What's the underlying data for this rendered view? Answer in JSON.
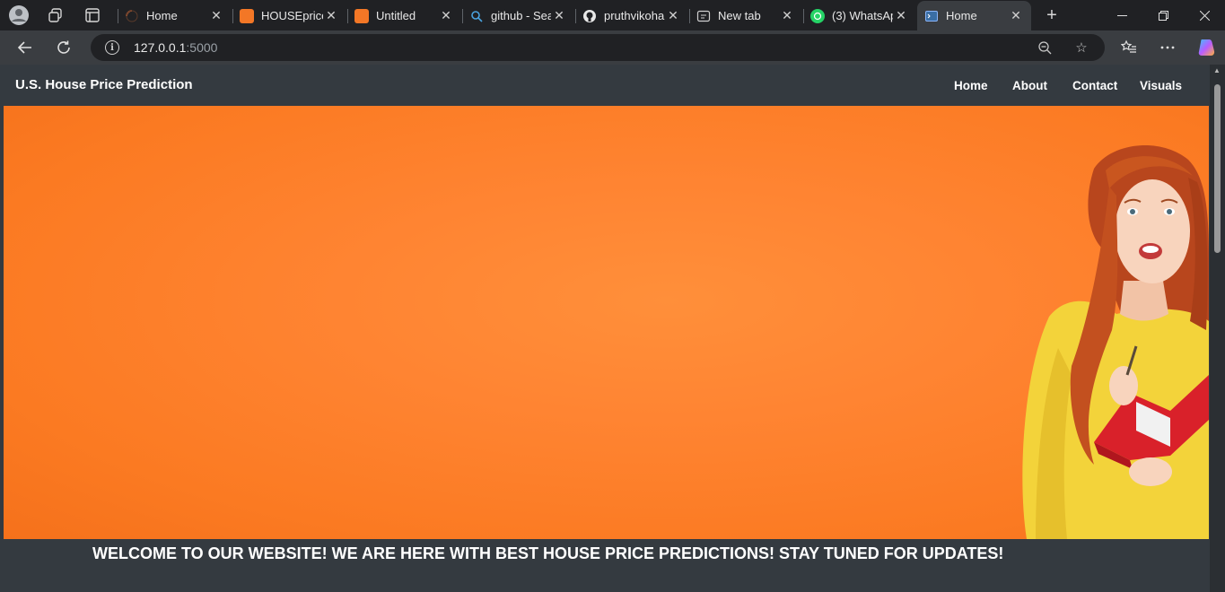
{
  "browser": {
    "tabs": [
      {
        "title": "Home",
        "favicon": "loading-spinner-icon",
        "active": false
      },
      {
        "title": "HOUSEprice",
        "favicon": "jupyter-book-icon",
        "active": false
      },
      {
        "title": "Untitled",
        "favicon": "jupyter-book-icon",
        "active": false
      },
      {
        "title": "github - Sea",
        "favicon": "search-icon",
        "active": false
      },
      {
        "title": "pruthvikoha",
        "favicon": "github-icon",
        "active": false
      },
      {
        "title": "New tab",
        "favicon": "new-tab-icon",
        "active": false
      },
      {
        "title": "(3) WhatsAp",
        "favicon": "whatsapp-icon",
        "active": false
      },
      {
        "title": "Home",
        "favicon": "terminal-page-icon",
        "active": true
      }
    ],
    "address": {
      "host": "127.0.0.1",
      "port": ":5000"
    }
  },
  "site": {
    "brand": "U.S. House Price Prediction",
    "nav": [
      {
        "label": "Home"
      },
      {
        "label": "About"
      },
      {
        "label": "Contact"
      },
      {
        "label": "Visuals"
      }
    ],
    "hero": {
      "image": "woman-holding-red-book-on-orange-background"
    },
    "welcome": "WELCOME TO OUR WEBSITE! WE ARE HERE WITH BEST HOUSE PRICE PREDICTIONS! STAY TUNED FOR UPDATES!"
  },
  "colors": {
    "accent_orange": "#ff8432",
    "navbar": "#343a40"
  }
}
